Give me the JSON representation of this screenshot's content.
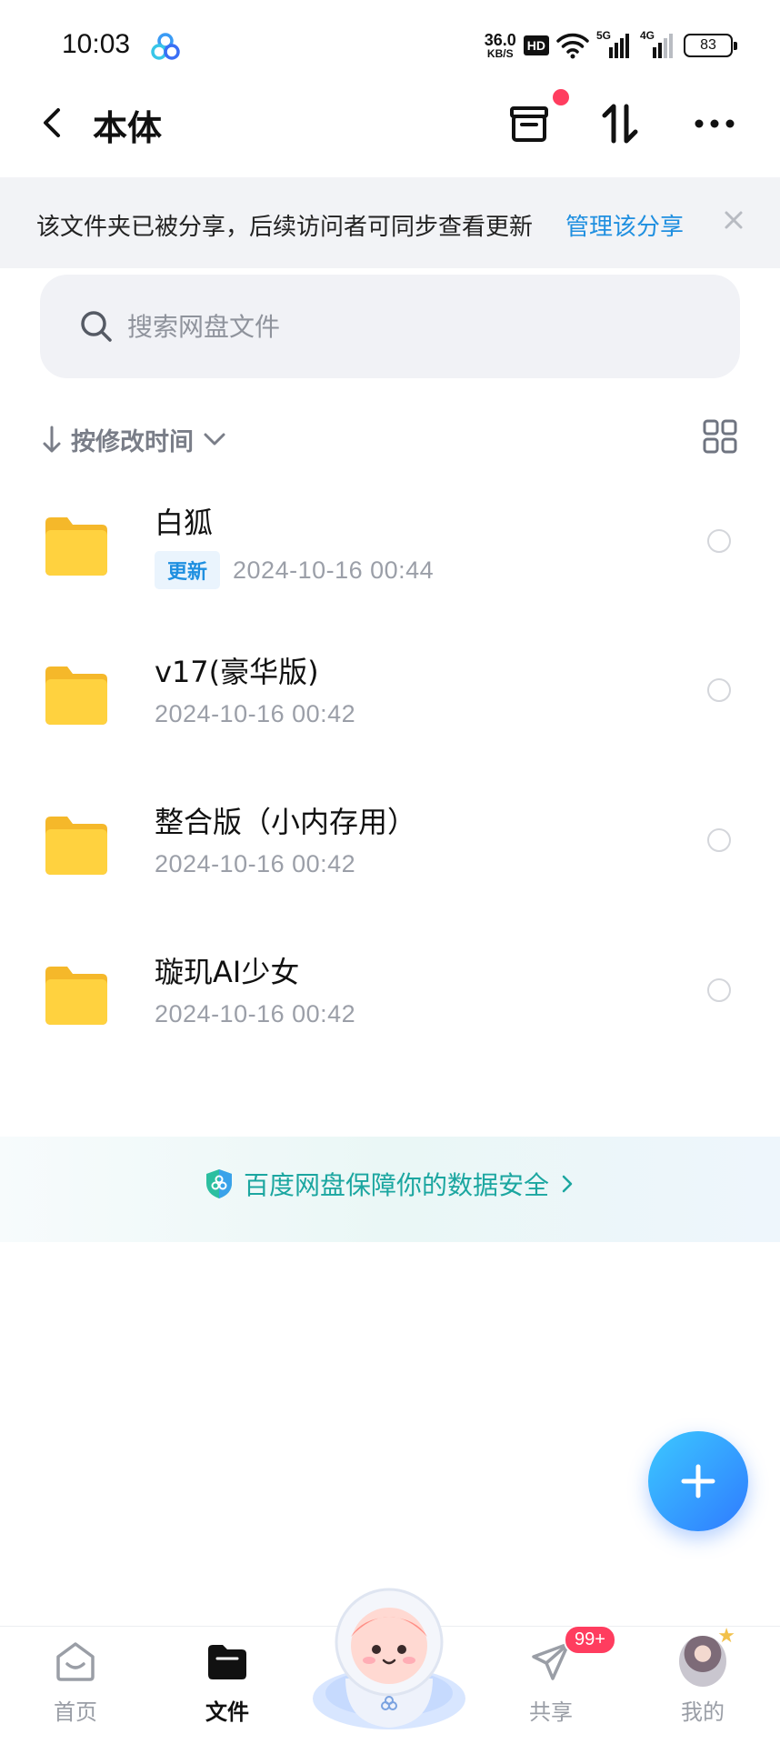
{
  "status_bar": {
    "time": "10:03",
    "net_speed_value": "36.0",
    "net_speed_unit": "KB/S",
    "hd_label": "HD",
    "signal_1": "5G",
    "signal_2": "4G",
    "battery": "83"
  },
  "header": {
    "title": "本体",
    "has_notification": true
  },
  "share_notice": {
    "text": "该文件夹已被分享，后续访问者可同步查看更新",
    "link": "管理该分享"
  },
  "search": {
    "placeholder": "搜索网盘文件"
  },
  "sort": {
    "label": "按修改时间"
  },
  "files": [
    {
      "name": "白狐",
      "badge": "更新",
      "time": "2024-10-16  00:44"
    },
    {
      "name": "v17(豪华版)",
      "badge": "",
      "time": "2024-10-16  00:42"
    },
    {
      "name": "整合版（小内存用）",
      "badge": "",
      "time": "2024-10-16  00:42"
    },
    {
      "name": "璇玑AI少女",
      "badge": "",
      "time": "2024-10-16  00:42"
    }
  ],
  "security_banner": {
    "text": "百度网盘保障你的数据安全"
  },
  "bottom_nav": {
    "home": "首页",
    "files": "文件",
    "share": "共享",
    "share_badge": "99+",
    "mine": "我的"
  },
  "colors": {
    "accent": "#1f8fe0",
    "folder": "#ffc933",
    "security_text": "#1ba6a0",
    "badge_red": "#ff3d5f",
    "fab_start": "#3cc8ff",
    "fab_end": "#2f7bff"
  }
}
